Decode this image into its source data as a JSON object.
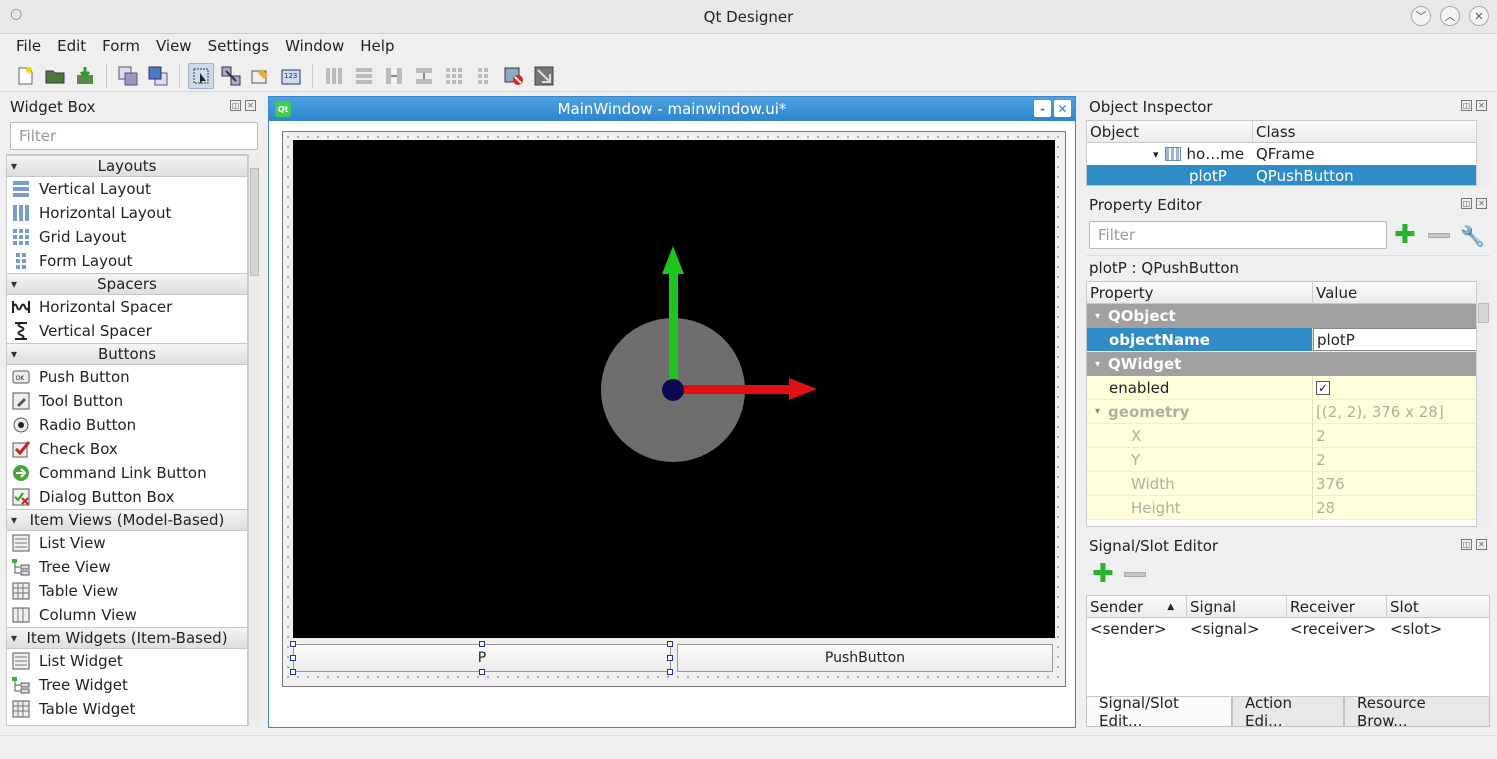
{
  "window": {
    "title": "Qt Designer",
    "dot": "○"
  },
  "menu": [
    "File",
    "Edit",
    "Form",
    "View",
    "Settings",
    "Window",
    "Help"
  ],
  "widget_box": {
    "title": "Widget Box",
    "filter_placeholder": "Filter",
    "categories": [
      {
        "name": "Layouts",
        "items": [
          {
            "label": "Vertical Layout",
            "icon": "vertical-layout-icon"
          },
          {
            "label": "Horizontal Layout",
            "icon": "horizontal-layout-icon"
          },
          {
            "label": "Grid Layout",
            "icon": "grid-layout-icon"
          },
          {
            "label": "Form Layout",
            "icon": "form-layout-icon"
          }
        ]
      },
      {
        "name": "Spacers",
        "items": [
          {
            "label": "Horizontal Spacer",
            "icon": "horizontal-spacer-icon"
          },
          {
            "label": "Vertical Spacer",
            "icon": "vertical-spacer-icon"
          }
        ]
      },
      {
        "name": "Buttons",
        "items": [
          {
            "label": "Push Button",
            "icon": "push-button-icon"
          },
          {
            "label": "Tool Button",
            "icon": "tool-button-icon"
          },
          {
            "label": "Radio Button",
            "icon": "radio-button-icon"
          },
          {
            "label": "Check Box",
            "icon": "check-box-icon"
          },
          {
            "label": "Command Link Button",
            "icon": "command-link-icon"
          },
          {
            "label": "Dialog Button Box",
            "icon": "dialog-button-box-icon"
          }
        ]
      },
      {
        "name": "Item Views (Model-Based)",
        "items": [
          {
            "label": "List View",
            "icon": "list-view-icon"
          },
          {
            "label": "Tree View",
            "icon": "tree-view-icon"
          },
          {
            "label": "Table View",
            "icon": "table-view-icon"
          },
          {
            "label": "Column View",
            "icon": "column-view-icon"
          }
        ]
      },
      {
        "name": "Item Widgets (Item-Based)",
        "items": [
          {
            "label": "List Widget",
            "icon": "list-widget-icon"
          },
          {
            "label": "Tree Widget",
            "icon": "tree-widget-icon"
          },
          {
            "label": "Table Widget",
            "icon": "table-widget-icon"
          }
        ]
      }
    ]
  },
  "mdi": {
    "title": "MainWindow - mainwindow.ui*",
    "minimize": "-",
    "close": "✕",
    "qt_logo": "Qt"
  },
  "form": {
    "button_left": "P",
    "button_right": "PushButton"
  },
  "object_inspector": {
    "title": "Object Inspector",
    "col_object": "Object",
    "col_class": "Class",
    "rows": [
      {
        "object": "ho…me",
        "class": "QFrame"
      },
      {
        "object": "plotP",
        "class": "QPushButton"
      }
    ]
  },
  "property_editor": {
    "title": "Property Editor",
    "filter_placeholder": "Filter",
    "subject": "plotP : QPushButton",
    "col_property": "Property",
    "col_value": "Value",
    "rows": [
      {
        "k": "QObject",
        "v": "",
        "kind": "group"
      },
      {
        "k": "objectName",
        "v": "plotP",
        "kind": "selected"
      },
      {
        "k": "QWidget",
        "v": "",
        "kind": "group"
      },
      {
        "k": "enabled",
        "v": "✓",
        "kind": "normal"
      },
      {
        "k": "geometry",
        "v": "[(2, 2), 376 x 28]",
        "kind": "dim-parent"
      },
      {
        "k": "X",
        "v": "2",
        "kind": "dim"
      },
      {
        "k": "Y",
        "v": "2",
        "kind": "dim"
      },
      {
        "k": "Width",
        "v": "376",
        "kind": "dim"
      },
      {
        "k": "Height",
        "v": "28",
        "kind": "dim"
      }
    ]
  },
  "signal_slot": {
    "title": "Signal/Slot Editor",
    "headers": [
      "Sender",
      "Signal",
      "Receiver",
      "Slot"
    ],
    "row": [
      "<sender>",
      "<signal>",
      "<receiver>",
      "<slot>"
    ]
  },
  "bottom_tabs": [
    "Signal/Slot Edit...",
    "Action Edi...",
    "Resource Brow..."
  ],
  "colors": {
    "accent": "#3a8ee6",
    "selected_row": "#308cc6",
    "mdi_title": "#2f85cc"
  }
}
